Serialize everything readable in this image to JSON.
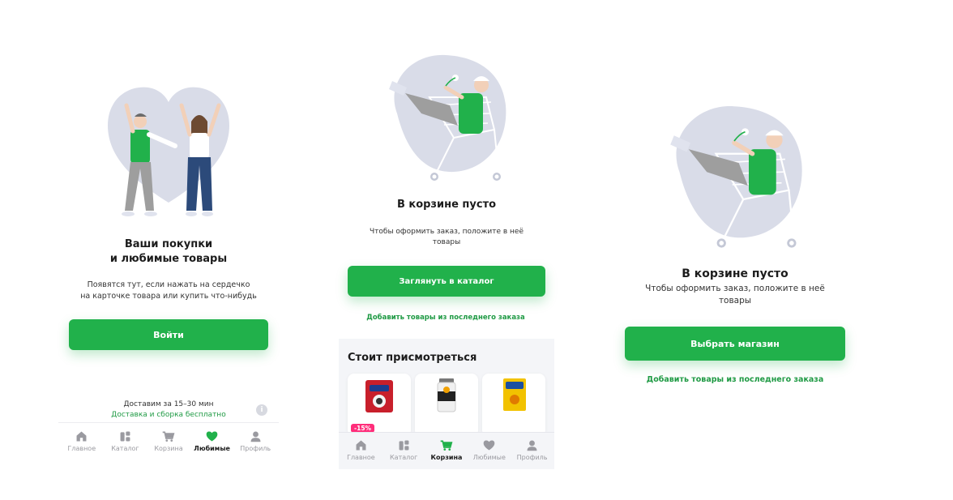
{
  "panel1": {
    "title_line1": "Ваши покупки",
    "title_line2": "и любимые товары",
    "subtitle_line1": "Появятся тут, если нажать на сердечко",
    "subtitle_line2": "на карточке товара или купить что-нибудь",
    "login_button": "Войти",
    "delivery_time": "Доставим за 15–30 мин",
    "delivery_free": "Доставка и сборка бесплатно",
    "info_icon_glyph": "i",
    "tabs": [
      {
        "label": "Главное",
        "icon": "home-icon"
      },
      {
        "label": "Каталог",
        "icon": "catalog-icon"
      },
      {
        "label": "Корзина",
        "icon": "cart-icon"
      },
      {
        "label": "Любимые",
        "icon": "heart-icon"
      },
      {
        "label": "Профиль",
        "icon": "profile-icon"
      }
    ],
    "active_tab": "Любимые"
  },
  "panel2": {
    "title": "В корзине пусто",
    "subtitle_line1": "Чтобы оформить заказ, положите в неё",
    "subtitle_line2": "товары",
    "catalog_button": "Заглянуть в каталог",
    "last_order_link": "Добавить товары из последнего заказа",
    "recommend_title": "Стоит присмотреться",
    "discount_badge": "-15%",
    "tabs": [
      {
        "label": "Главное",
        "icon": "home-icon"
      },
      {
        "label": "Каталог",
        "icon": "catalog-icon"
      },
      {
        "label": "Корзина",
        "icon": "cart-icon"
      },
      {
        "label": "Любимые",
        "icon": "heart-icon"
      },
      {
        "label": "Профиль",
        "icon": "profile-icon"
      }
    ],
    "active_tab": "Корзина"
  },
  "panel3": {
    "title": "В корзине пусто",
    "subtitle_line1": "Чтобы оформить заказ, положите в неё",
    "subtitle_line2": "товары",
    "store_button": "Выбрать магазин",
    "last_order_link": "Добавить товары из последнего заказа"
  },
  "colors": {
    "accent_green": "#21b14b",
    "link_green": "#1f9a44",
    "illustration_blob": "#d9dce8",
    "discount_pink": "#ff2d7a",
    "tab_inactive": "#9a9aa0"
  }
}
